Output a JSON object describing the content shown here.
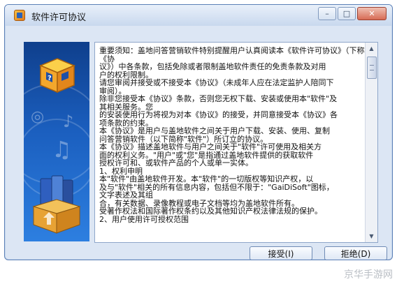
{
  "window": {
    "title": "软件许可协议",
    "controls": {
      "minimize": "–",
      "maximize": "□",
      "close": "✕"
    }
  },
  "license": {
    "lines": [
      "重要须知：盖地问答营销软件特别提醒用户认真阅读本《软件许可协议》（下称《协",
      "议》）中各条款，包括免除或者限制盖地软件责任的免责条款及对用",
      "户的权利限制。",
      "请您审阅并接受或不接受本《协议》（未成年人应在法定监护人陪同下",
      "审阅）。",
      "除非您接受本《协议》条款，否则您无权下载、安装或使用本\"软件\"及",
      "其相关服务。您",
      "的安装使用行为将视为对本《协议》的接受，并同意接受本《协议》各",
      "项条款的约束。",
      "本《协议》是用户与盖地软件之间关于用户下载、安装、使用、复制",
      "问答营销软件（以下简称\"软件\"）所订立的协议。",
      "本《协议》描述盖地软件与用户之间关于\"软件\"许可使用及相关方",
      "面的权利义务。\"用户\"或\"您\"是指通过盖地软件提供的获取软件",
      "授权许可和、或软件产品的个人或单一实体。",
      "1、权利申明",
      "本\"软件\"由盖地软件开发。本\"软件\"的一切版权等知识产权，以",
      "及与\"软件\"相关的所有信息内容，包括但不限于：\"GaiDiSoft\"图标，",
      "文字表述及其组",
      "合，有关数据、录像教程或电子文档等均为盖地软件所有。",
      "受著作权法和国际著作权条约以及其他知识产权法律法规的保护。",
      "2、用户使用许可授权范围"
    ]
  },
  "buttons": {
    "accept": "接受(I)",
    "reject": "拒绝(D)"
  },
  "watermark": "京华手游网",
  "colors": {
    "banner_top": "#0f3f8c",
    "banner_bottom": "#2d7fe0",
    "frame": "#dce6f4"
  },
  "icons": {
    "app": "app-box-icon",
    "banner_top": "question-box-icon",
    "banner_bottom": "books-box-icon"
  }
}
